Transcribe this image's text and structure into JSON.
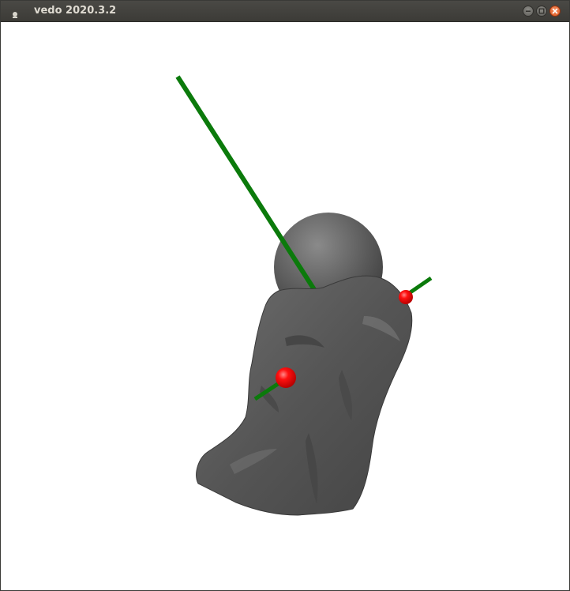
{
  "window": {
    "title": "vedo 2020.3.2"
  },
  "titlebar": {
    "app_icon": "app-icon",
    "buttons": [
      {
        "name": "minimize",
        "icon": "minimize-icon"
      },
      {
        "name": "maximize",
        "icon": "maximize-icon"
      },
      {
        "name": "close",
        "icon": "close-icon"
      }
    ]
  },
  "scene": {
    "background": "#ffffff",
    "mesh_color": "#5a5a5a",
    "sphere_color": "#5f5f5f",
    "line_color": "#0b7a0b",
    "marker_color": "#ff0000"
  }
}
